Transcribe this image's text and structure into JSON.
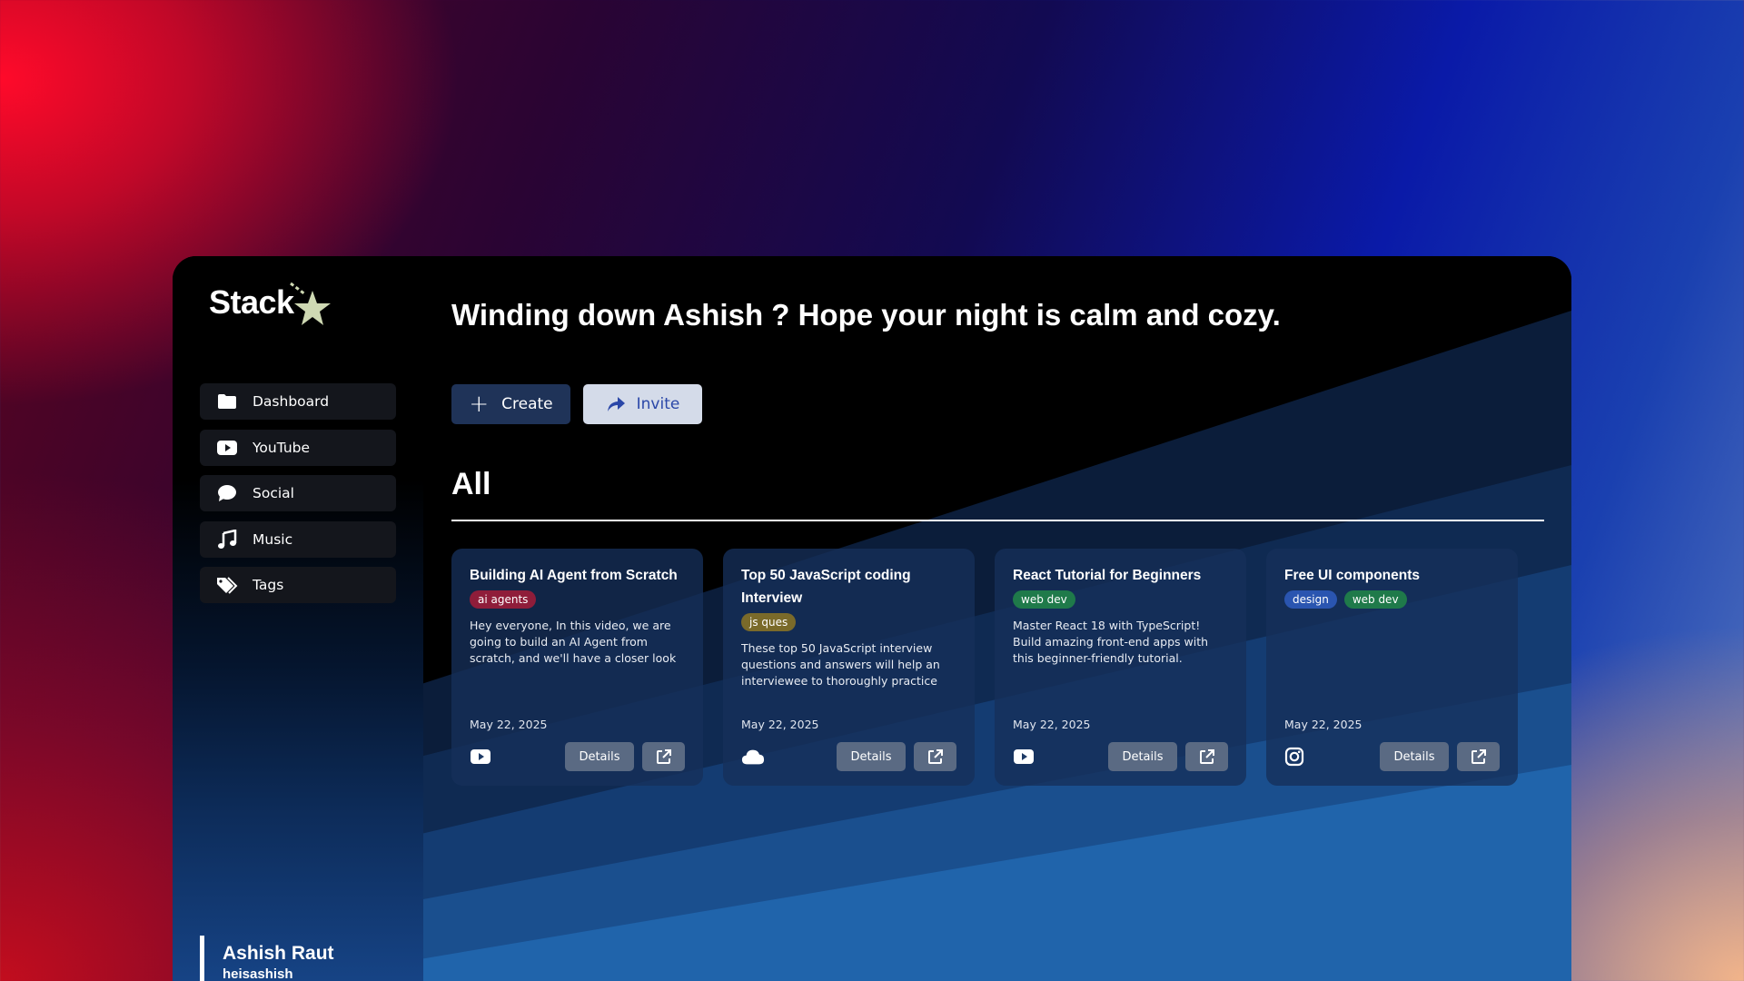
{
  "app": {
    "logo_text": "Stack"
  },
  "greeting": "Winding down Ashish ? Hope your night is calm and cozy.",
  "sidebar": {
    "items": [
      {
        "label": "Dashboard",
        "icon": "folder-icon"
      },
      {
        "label": "YouTube",
        "icon": "youtube-icon"
      },
      {
        "label": "Social",
        "icon": "chat-bubble-icon"
      },
      {
        "label": "Music",
        "icon": "music-note-icon"
      },
      {
        "label": "Tags",
        "icon": "tags-icon"
      }
    ]
  },
  "user": {
    "name": "Ashish Raut",
    "handle": "heisashish"
  },
  "actions": {
    "create_label": "Create",
    "invite_label": "Invite"
  },
  "section": {
    "title": "All"
  },
  "cards": [
    {
      "title": "Building AI Agent from Scratch",
      "tags": [
        {
          "label": "ai agents",
          "color": "#8f1d3a"
        }
      ],
      "description": "Hey everyone, In this video, we are going to build an AI Agent from scratch, and we'll have a closer look at",
      "date": "May 22, 2025",
      "source_icon": "youtube-icon",
      "details_label": "Details"
    },
    {
      "title": "Top 50 JavaScript coding Interview",
      "tags": [
        {
          "label": "js ques",
          "color": "#7a6a2a"
        }
      ],
      "description": "These top 50 JavaScript interview questions and answers will help an interviewee to thoroughly practice and",
      "date": "May 22, 2025",
      "source_icon": "cloud-icon",
      "details_label": "Details"
    },
    {
      "title": "React Tutorial for Beginners",
      "tags": [
        {
          "label": "web dev",
          "color": "#1f7a4a"
        }
      ],
      "description": "Master React 18 with TypeScript! Build amazing front-end apps with this beginner-friendly tutorial.",
      "date": "May 22, 2025",
      "source_icon": "youtube-icon",
      "details_label": "Details"
    },
    {
      "title": "Free UI components",
      "tags": [
        {
          "label": "design",
          "color": "#2a55b0"
        },
        {
          "label": "web dev",
          "color": "#1f7a4a"
        }
      ],
      "description": "",
      "date": "May 22, 2025",
      "source_icon": "instagram-icon",
      "details_label": "Details"
    }
  ]
}
